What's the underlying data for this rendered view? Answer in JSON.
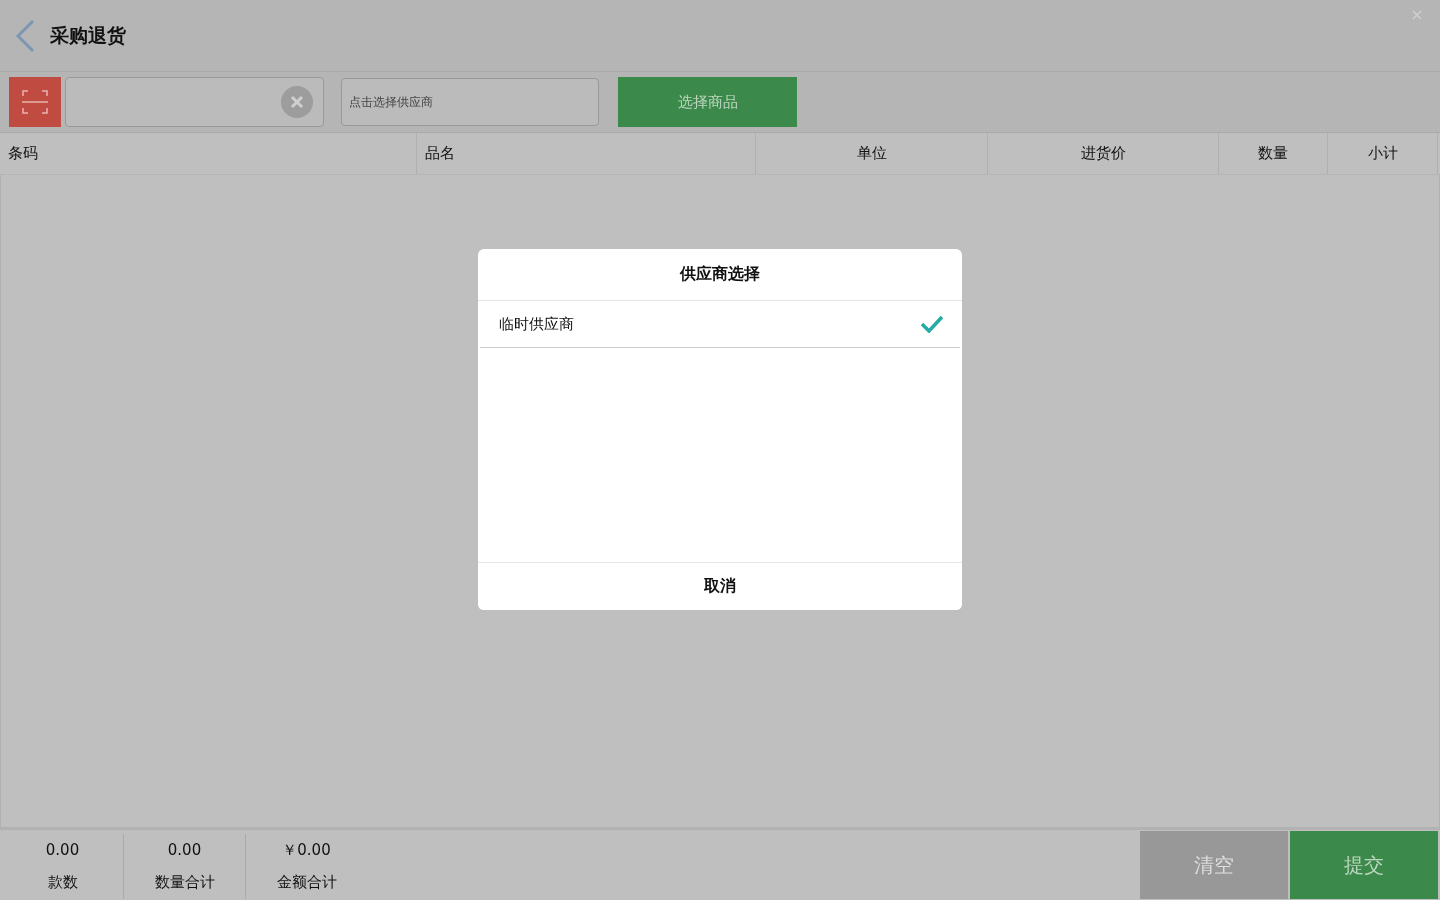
{
  "header": {
    "title": "采购退货"
  },
  "toolbar": {
    "supplier_field": {
      "placeholder": "点击选择供应商"
    },
    "select_goods_button": "选择商品"
  },
  "table": {
    "columns": [
      "条码",
      "品名",
      "单位",
      "进货价",
      "数量",
      "小计"
    ]
  },
  "summary": [
    {
      "value": "0.00",
      "label": "款数"
    },
    {
      "value": "0.00",
      "label": "数量合计"
    },
    {
      "value": "￥0.00",
      "label": "金额合计"
    }
  ],
  "actions": {
    "clear_button": "清空",
    "submit_button": "提交"
  },
  "dialog": {
    "title": "供应商选择",
    "options": [
      {
        "label": "临时供应商",
        "selected": true
      }
    ],
    "cancel_button": "取消"
  }
}
